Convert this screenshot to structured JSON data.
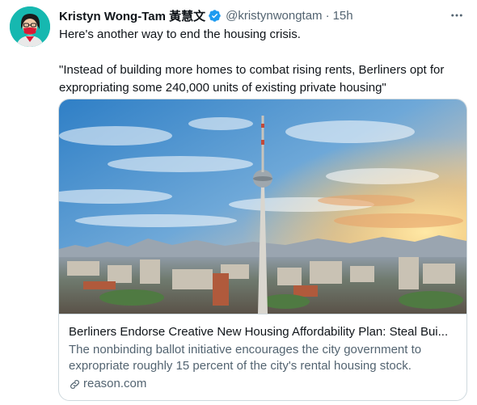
{
  "tweet": {
    "display_name": "Kristyn Wong-Tam 黃慧文",
    "handle": "@kristynwongtam",
    "separator": "·",
    "time": "15h",
    "text_line1": "Here's another way to end the housing crisis.",
    "text_quote": "\"Instead of building more homes to combat rising rents, Berliners opt for expropriating some 240,000 units of existing private housing\""
  },
  "card": {
    "title": "Berliners Endorse Creative New Housing Affordability Plan: Steal Bui...",
    "description": "The nonbinding ballot initiative encourages the city government to expropriate roughly 15 percent of the city's rental housing stock.",
    "domain": "reason.com"
  },
  "icons": {
    "verified": "verified-badge-icon",
    "more": "more-options-icon",
    "link": "link-icon"
  },
  "colors": {
    "text_primary": "#0f1419",
    "text_secondary": "#536471",
    "verified_blue": "#1d9bf0",
    "border": "#cfd9de",
    "avatar_bg": "#16b8b0"
  }
}
